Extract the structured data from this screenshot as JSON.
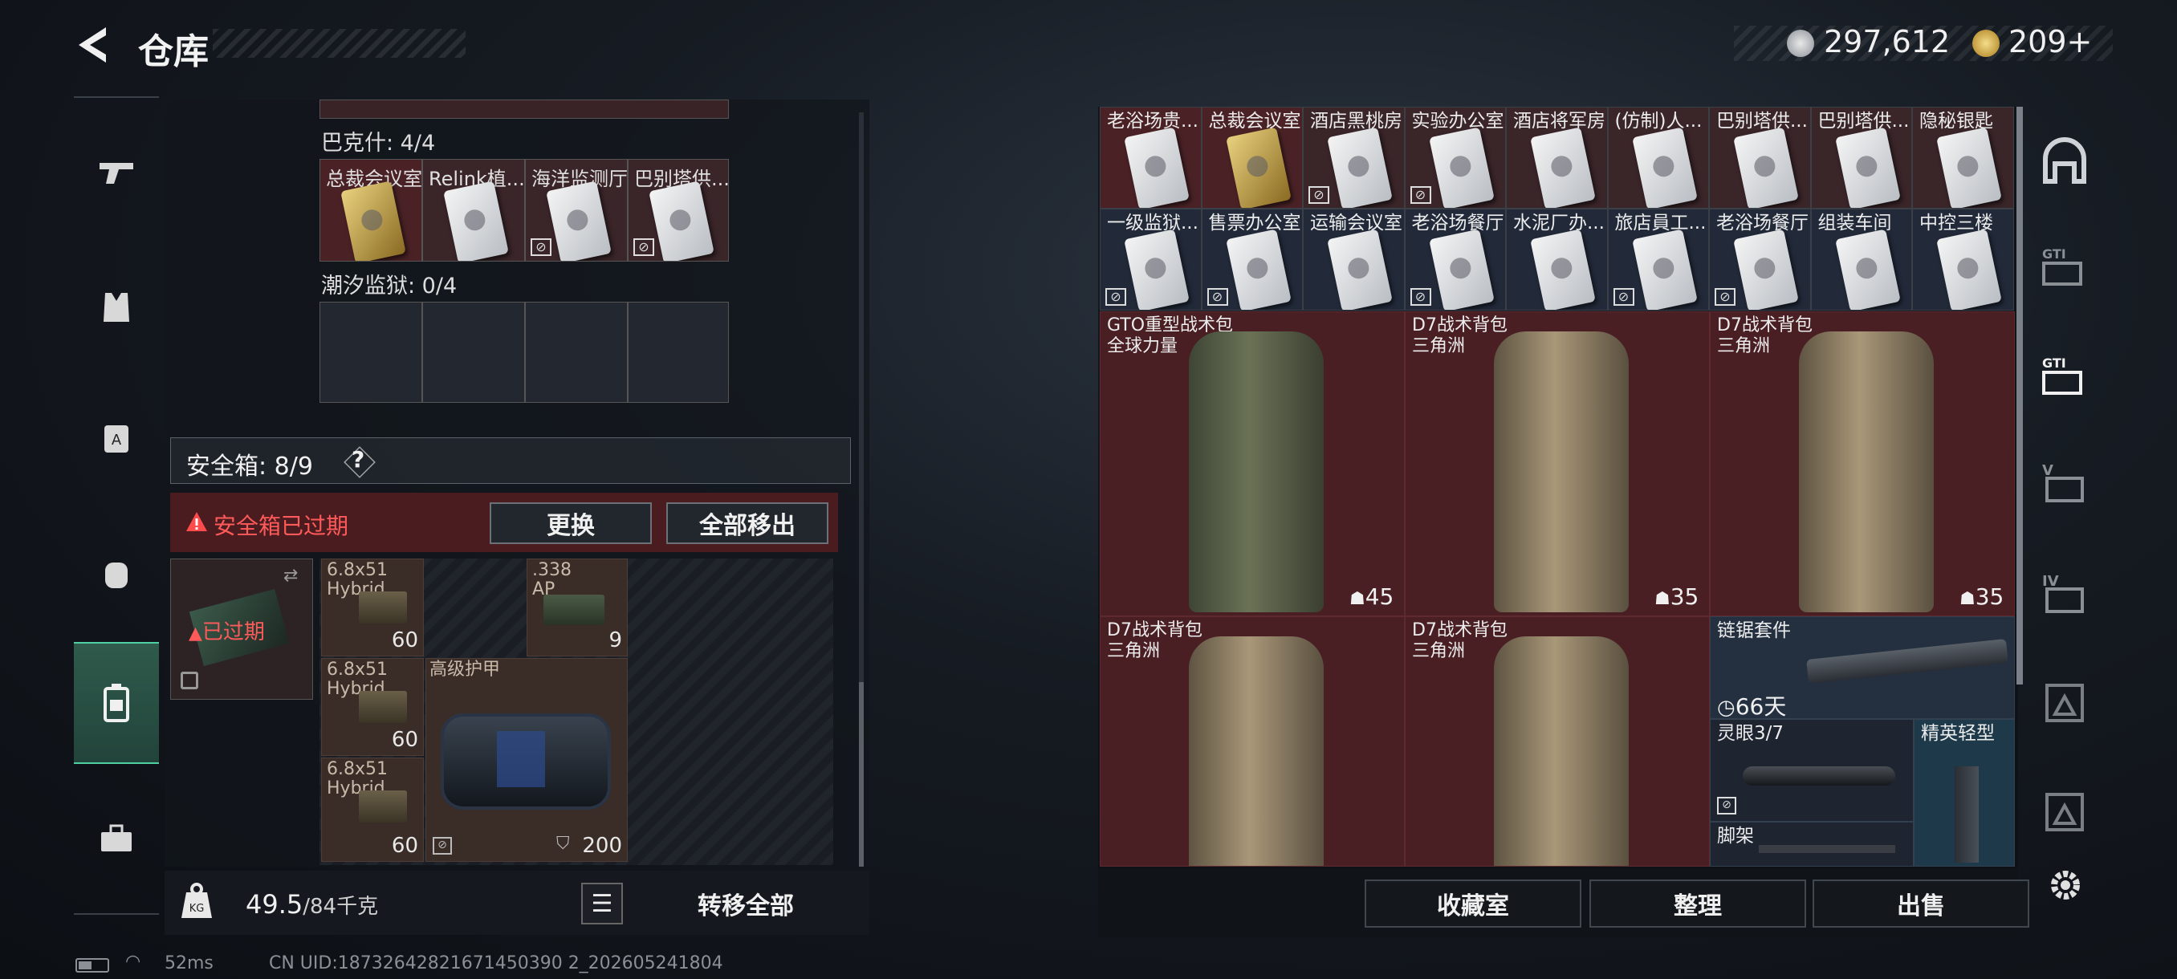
{
  "header": {
    "title": "仓库"
  },
  "currency": {
    "silver": "297,612",
    "gold": "209+"
  },
  "left": {
    "group1_title": "巴克什: 4/4",
    "group1_items": [
      {
        "label": "总裁会议室",
        "rarity": "gold"
      },
      {
        "label": "Relink植...",
        "rarity": "white"
      },
      {
        "label": "海洋监测厅",
        "rarity": "white"
      },
      {
        "label": "巴别塔供...",
        "rarity": "white"
      }
    ],
    "group2_title": "潮汐监狱: 0/4",
    "safebox_label": "安全箱: 8/9",
    "safebox_help": "?",
    "expired_alert": "安全箱已过期",
    "replace_button": "更换",
    "remove_all_button": "全部移出",
    "expired_tag": "已过期",
    "ammo": [
      {
        "label": "6.8x51\nHybrid",
        "count": "60"
      },
      {
        "label": ".338\nAP",
        "count": "9"
      },
      {
        "label": "6.8x51\nHybrid",
        "count": "60"
      },
      {
        "label": "6.8x51\nHybrid",
        "count": "60"
      }
    ],
    "armor_label": "高级护甲",
    "armor_durability": "200",
    "weight_current": "49.5",
    "weight_max": "/84千克",
    "transfer_all": "转移全部"
  },
  "right": {
    "keys_row1": [
      "老浴场贵...",
      "总裁会议室",
      "酒店黑桃房",
      "实验办公室",
      "酒店将军房",
      "(仿制)人...",
      "巴别塔供...",
      "巴别塔供...",
      "隐秘银匙"
    ],
    "keys_row2": [
      "一级监狱...",
      "售票办公室",
      "运输会议室",
      "老浴场餐厅",
      "水泥厂办...",
      "旅店員工...",
      "老浴场餐厅",
      "组装车间",
      "中控三楼"
    ],
    "backpacks": [
      {
        "name": "GTO重型战术包",
        "sub": "全球力量",
        "count": "45"
      },
      {
        "name": "D7战术背包",
        "sub": "三角洲",
        "count": "35"
      },
      {
        "name": "D7战术背包",
        "sub": "三角洲",
        "count": "35"
      },
      {
        "name": "D7战术背包",
        "sub": "三角洲",
        "count": ""
      },
      {
        "name": "D7战术背包",
        "sub": "三角洲",
        "count": ""
      }
    ],
    "chainsaw_label": "链锯套件",
    "chainsaw_days": "66天",
    "scope_label": "灵眼3/7",
    "stock_label": "精英轻型",
    "bipod_label": "脚架",
    "collection_button": "收藏室",
    "sort_button": "整理",
    "sell_button": "出售"
  },
  "status": {
    "ping": "52ms",
    "uid": "CN UID:18732642821671450390 2_202605241804"
  }
}
